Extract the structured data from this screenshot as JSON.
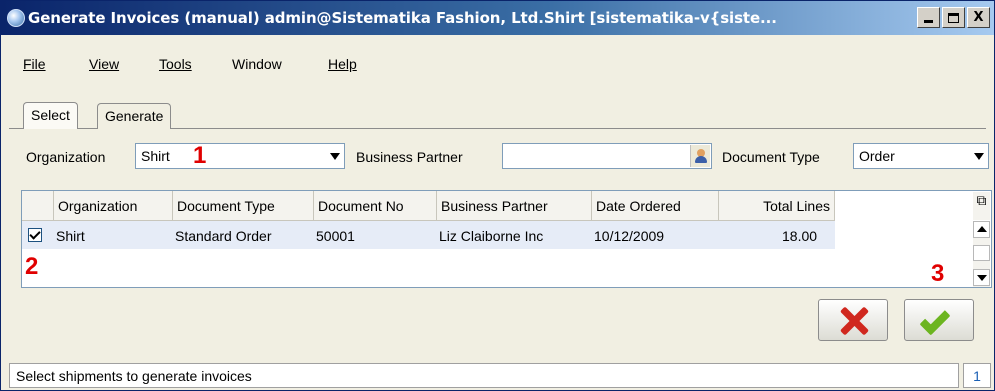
{
  "window": {
    "title": "Generate Invoices (manual)  admin@Sistematika Fashion, Ltd.Shirt [sistematika-v{siste...",
    "buttons": {
      "minimize": "minimize-icon",
      "maximize": "maximize-icon",
      "close": "X"
    }
  },
  "menu": [
    "File",
    "View",
    "Tools",
    "Window",
    "Help"
  ],
  "tabs": [
    {
      "label": "Select",
      "active": true
    },
    {
      "label": "Generate",
      "active": false
    }
  ],
  "params": {
    "organization": {
      "label": "Organization",
      "value": "Shirt"
    },
    "business_partner": {
      "label": "Business Partner",
      "value": ""
    },
    "document_type": {
      "label": "Document Type",
      "value": "Order"
    }
  },
  "table": {
    "columns": [
      "",
      "Organization",
      "Document Type",
      "Document No",
      "Business Partner",
      "Date Ordered",
      "Total Lines"
    ],
    "rows": [
      {
        "selected": true,
        "organization": "Shirt",
        "document_type": "Standard Order",
        "document_no": "50001",
        "business_partner": "Liz Claiborne Inc",
        "date_ordered": "10/12/2009",
        "total_lines": "18.00"
      }
    ]
  },
  "annotations": [
    "1",
    "2",
    "3"
  ],
  "colors": {
    "annotation": "#e00000",
    "selected_row": "#e6ecf7",
    "titlebar_start": "#0a246a"
  },
  "actions": {
    "cancel_icon": "x-icon",
    "ok_icon": "check-icon"
  },
  "status": {
    "message": "Select shipments to generate invoices",
    "count": "1"
  }
}
